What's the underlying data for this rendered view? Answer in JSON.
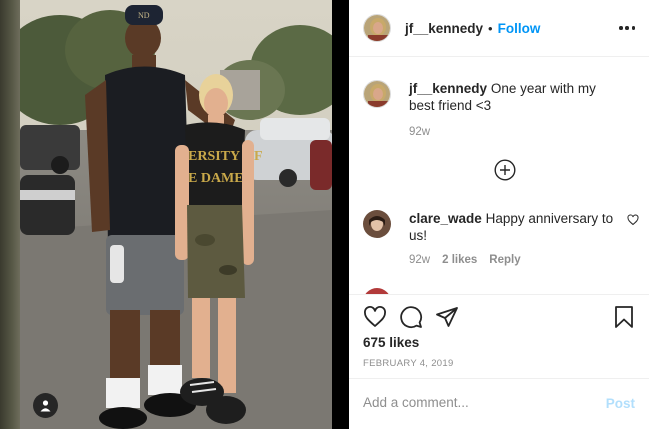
{
  "post": {
    "username": "jf__kennedy",
    "follow_label": "Follow",
    "dot": "•",
    "caption": "One year with my best friend <3",
    "caption_time": "92w",
    "likes": "675 likes",
    "date": "FEBRUARY 4, 2019"
  },
  "comments": [
    {
      "username": "clare_wade",
      "text": "Happy anniversary to us!",
      "time": "92w",
      "likes": "2 likes",
      "reply_label": "Reply"
    }
  ],
  "add_comment": {
    "placeholder": "Add a comment...",
    "post_label": "Post"
  },
  "photo": {
    "cap_logo": "ND",
    "shirt_text_line1": "ERSITY OF",
    "shirt_text_line2": "E DAME"
  },
  "colors": {
    "follow_blue": "#0095f6",
    "post_disabled": "#b2dffc",
    "meta_gray": "#8e8e8e"
  },
  "icons": [
    "tag-people-icon",
    "more-options-icon",
    "load-more-icon",
    "heart-icon",
    "comment-icon",
    "share-icon",
    "bookmark-icon"
  ]
}
